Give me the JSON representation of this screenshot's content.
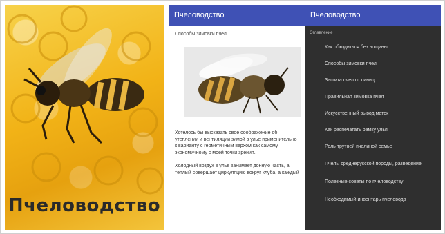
{
  "cover": {
    "title": "Пчеловодство"
  },
  "app": {
    "title": "Пчеловодство"
  },
  "article": {
    "heading": "Способы зимовки пчел",
    "paragraph1": "Хотелось бы высказать свое соображение об утеплении и вентиляции зимой в улье применительно к варианту с герметичным верхом как самому экономичному с моей точки зрения.",
    "paragraph2": "Холодный воздух в улье занимает донную часть, а теплый совершает циркуляцию вокруг клуба, а каждый"
  },
  "drawer": {
    "title": "Пчеловодство",
    "section_label": "Оглавление",
    "items": [
      "Как обходиться без вощины",
      "Способы зимовки пчел",
      "Защита пчел от синиц",
      "Правильная зимовка пчел",
      "Искусственный вывод маток",
      "Как распечатать рамку улья",
      "Роль трутней пчелиной семье",
      "Пчелы среднерусской породы, разведение",
      "Полезные советы по пчеловодству",
      "Необходимый инвентарь пчеловода"
    ]
  },
  "colors": {
    "appbar": "#3f51b5",
    "drawer_bg": "#2f2f2f",
    "honey": "#f2b317"
  }
}
